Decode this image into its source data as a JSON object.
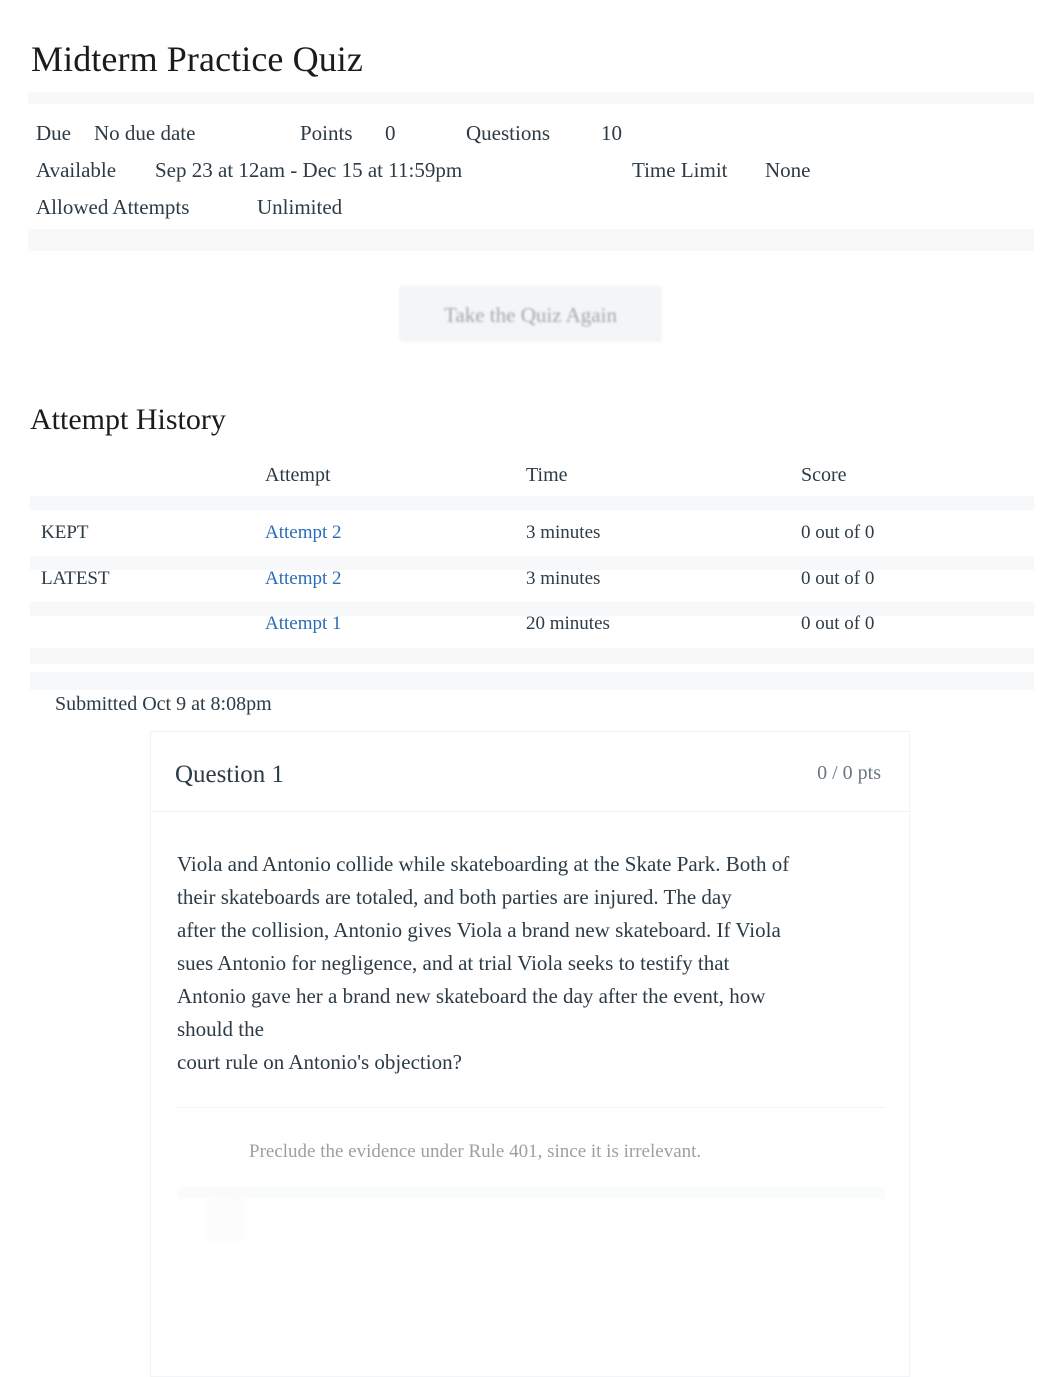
{
  "page": {
    "title": "Midterm Practice Quiz"
  },
  "quiz_meta": {
    "due_label": "Due",
    "due_value": "No due date",
    "points_label": "Points",
    "points_value": "0",
    "questions_label": "Questions",
    "questions_value": "10",
    "available_label": "Available",
    "available_value": "Sep 23 at 12am - Dec 15 at 11:59pm",
    "time_limit_label": "Time Limit",
    "time_limit_value": "None",
    "allowed_attempts_label": "Allowed Attempts",
    "allowed_attempts_value": "Unlimited"
  },
  "actions": {
    "retake_label": "Take the Quiz Again"
  },
  "attempt_history": {
    "heading": "Attempt History",
    "columns": [
      "",
      "Attempt",
      "Time",
      "Score"
    ],
    "rows": [
      {
        "kept": "KEPT",
        "attempt": "Attempt 2",
        "time": "3 minutes",
        "score": "0 out of 0"
      },
      {
        "kept": "LATEST",
        "attempt": "Attempt 2",
        "time": "3 minutes",
        "score": "0 out of 0"
      },
      {
        "kept": "",
        "attempt": "Attempt 1",
        "time": "20 minutes",
        "score": "0 out of 0"
      }
    ]
  },
  "submission": {
    "submitted_text": "Submitted Oct 9 at 8:08pm"
  },
  "question": {
    "name": "Question 1",
    "points": "0 / 0 pts",
    "body_lines": [
      "Viola and Antonio collide while skateboarding at the Skate Park. Both of",
      "their skateboards are totaled, and both parties are injured. The day",
      "after the collision, Antonio gives Viola a brand new skateboard. If Viola",
      "sues Antonio for negligence, and at trial Viola seeks to testify that",
      "Antonio gave her a brand new skateboard the day after the event, how",
      "should the",
      "court rule on Antonio's objection?"
    ],
    "answers": [
      {
        "text": "Preclude the evidence under Rule 401, since it is irrelevant."
      }
    ]
  },
  "colors": {
    "link": "#2b6cb8",
    "text": "#2d3b45",
    "muted": "#6b7780",
    "faded": "#9aa0a6",
    "divider": "#f7f8f9"
  }
}
